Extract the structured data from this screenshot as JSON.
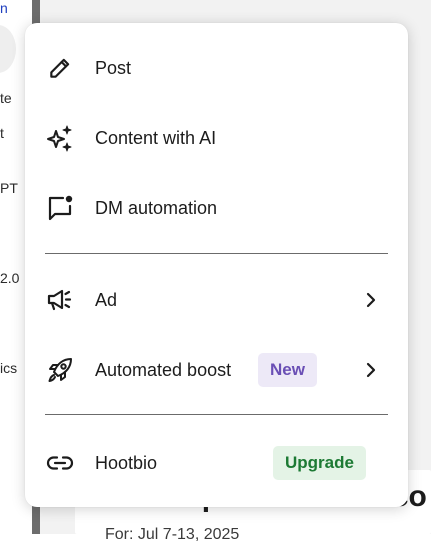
{
  "background": {
    "left_fragments": [
      "n",
      "te",
      "t",
      "PT",
      "2.0",
      "ics"
    ],
    "heading": "Social performance co",
    "subheading": "For: Jul 7-13, 2025"
  },
  "menu": {
    "items": [
      {
        "label": "Post",
        "icon": "pencil-icon"
      },
      {
        "label": "Content with AI",
        "icon": "sparkles-icon"
      },
      {
        "label": "DM automation",
        "icon": "message-dot-icon"
      },
      {
        "label": "Ad",
        "icon": "megaphone-icon",
        "submenu": true
      },
      {
        "label": "Automated boost",
        "icon": "rocket-icon",
        "badge": "New",
        "submenu": true
      },
      {
        "label": "Hootbio",
        "icon": "link-icon",
        "badge": "Upgrade"
      }
    ]
  },
  "colors": {
    "badge_new_bg": "#ede9f7",
    "badge_new_text": "#6a4fb5",
    "badge_upgrade_bg": "#e4f3e6",
    "badge_upgrade_text": "#1d7a34"
  }
}
